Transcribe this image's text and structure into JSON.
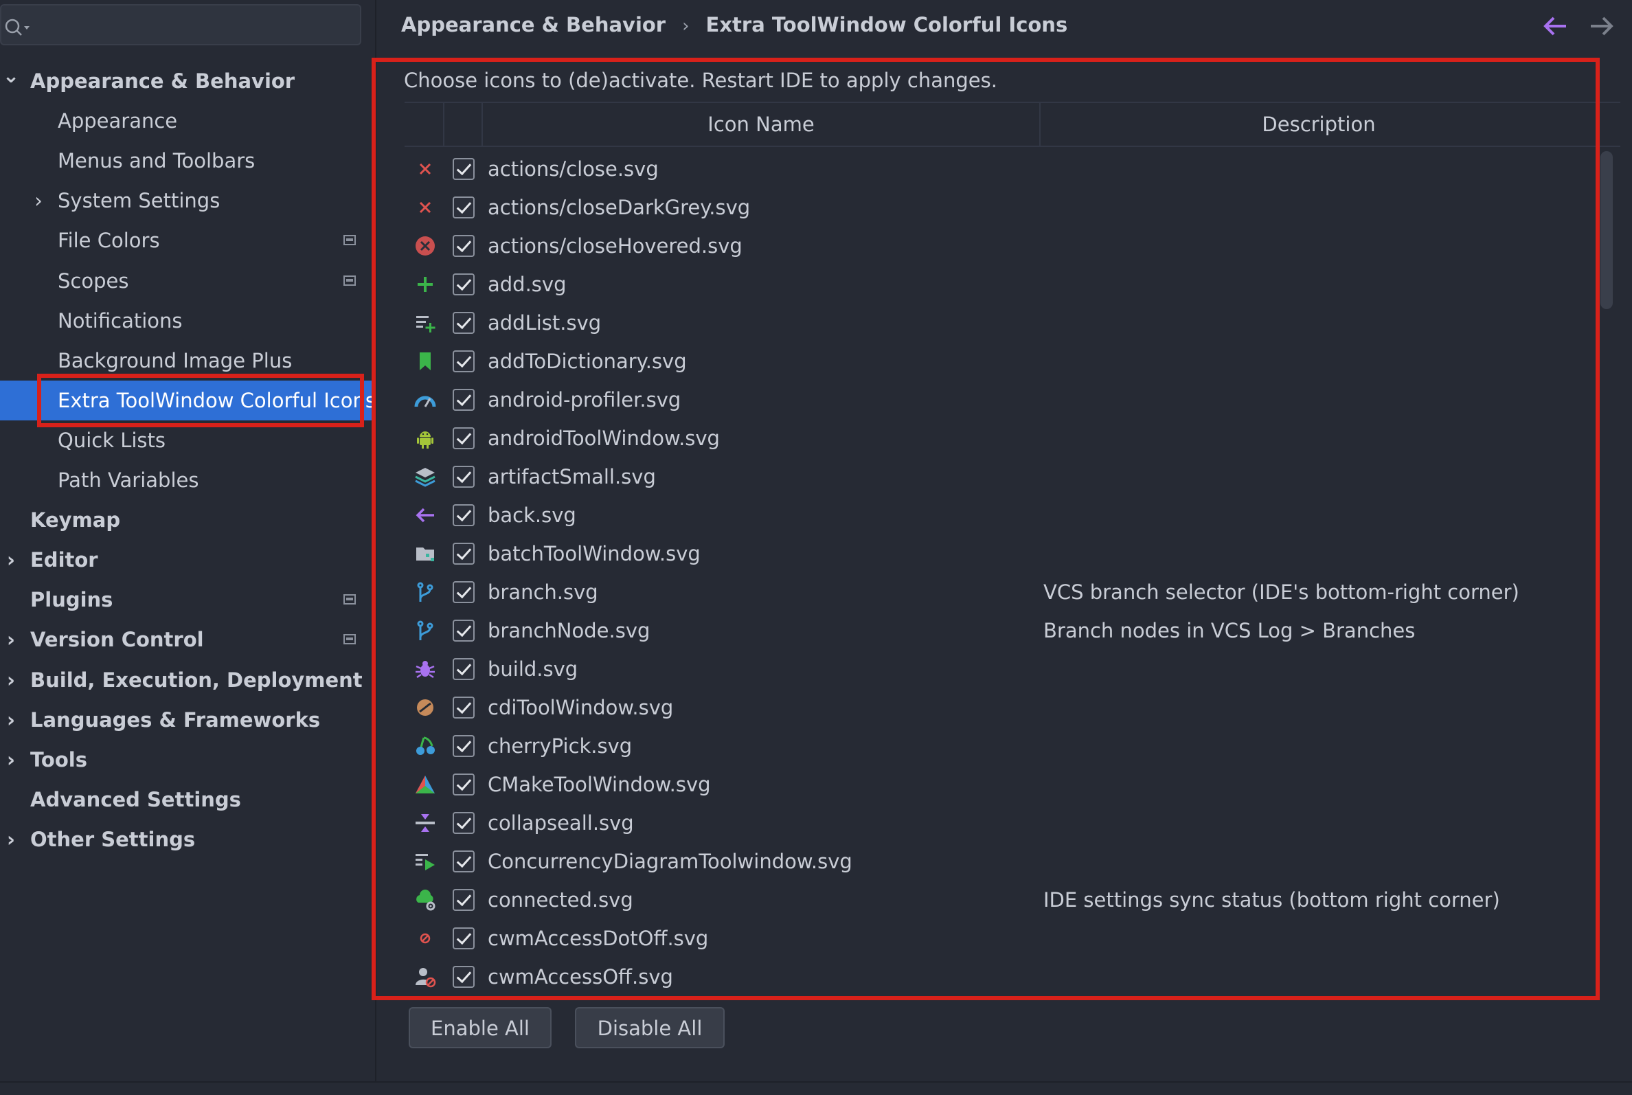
{
  "sidebar": {
    "search_placeholder": "",
    "items": [
      {
        "label": "Appearance & Behavior",
        "expander": "⌄",
        "bold": true,
        "level": 0
      },
      {
        "label": "Appearance",
        "expander": "",
        "bold": false,
        "level": 1
      },
      {
        "label": "Menus and Toolbars",
        "expander": "",
        "bold": false,
        "level": 1
      },
      {
        "label": "System Settings",
        "expander": "›",
        "bold": false,
        "level": 1
      },
      {
        "label": "File Colors",
        "expander": "",
        "bold": false,
        "level": 1,
        "project": true
      },
      {
        "label": "Scopes",
        "expander": "",
        "bold": false,
        "level": 1,
        "project": true
      },
      {
        "label": "Notifications",
        "expander": "",
        "bold": false,
        "level": 1
      },
      {
        "label": "Background Image Plus",
        "expander": "",
        "bold": false,
        "level": 1
      },
      {
        "label": "Extra ToolWindow Colorful Icons",
        "expander": "",
        "bold": false,
        "level": 1,
        "selected": true
      },
      {
        "label": "Quick Lists",
        "expander": "",
        "bold": false,
        "level": 1
      },
      {
        "label": "Path Variables",
        "expander": "",
        "bold": false,
        "level": 1
      },
      {
        "label": "Keymap",
        "expander": "",
        "bold": true,
        "level": 0
      },
      {
        "label": "Editor",
        "expander": "›",
        "bold": true,
        "level": 0
      },
      {
        "label": "Plugins",
        "expander": "",
        "bold": true,
        "level": 0,
        "project": true
      },
      {
        "label": "Version Control",
        "expander": "›",
        "bold": true,
        "level": 0,
        "project": true
      },
      {
        "label": "Build, Execution, Deployment",
        "expander": "›",
        "bold": true,
        "level": 0
      },
      {
        "label": "Languages & Frameworks",
        "expander": "›",
        "bold": true,
        "level": 0
      },
      {
        "label": "Tools",
        "expander": "›",
        "bold": true,
        "level": 0
      },
      {
        "label": "Advanced Settings",
        "expander": "",
        "bold": true,
        "level": 0
      },
      {
        "label": "Other Settings",
        "expander": "›",
        "bold": true,
        "level": 0
      }
    ]
  },
  "header": {
    "crumb_parent": "Appearance & Behavior",
    "crumb_sep": "›",
    "crumb_current": "Extra ToolWindow Colorful Icons",
    "back_icon": "arrow-left-icon",
    "forward_icon": "arrow-right-icon"
  },
  "main": {
    "instruction": "Choose icons to (de)activate. Restart IDE to apply changes.",
    "columns": {
      "icon": "",
      "enabled": "",
      "name": "Icon Name",
      "description": "Description"
    },
    "rows": [
      {
        "icon": "close",
        "name": "actions/close.svg",
        "description": "",
        "enabled": true
      },
      {
        "icon": "close",
        "name": "actions/closeDarkGrey.svg",
        "description": "",
        "enabled": true
      },
      {
        "icon": "close-hovered",
        "name": "actions/closeHovered.svg",
        "description": "",
        "enabled": true
      },
      {
        "icon": "add",
        "name": "add.svg",
        "description": "",
        "enabled": true
      },
      {
        "icon": "add-list",
        "name": "addList.svg",
        "description": "",
        "enabled": true
      },
      {
        "icon": "bookmark",
        "name": "addToDictionary.svg",
        "description": "",
        "enabled": true
      },
      {
        "icon": "gauge",
        "name": "android-profiler.svg",
        "description": "",
        "enabled": true
      },
      {
        "icon": "android",
        "name": "androidToolWindow.svg",
        "description": "",
        "enabled": true
      },
      {
        "icon": "layers",
        "name": "artifactSmall.svg",
        "description": "",
        "enabled": true
      },
      {
        "icon": "back",
        "name": "back.svg",
        "description": "",
        "enabled": true
      },
      {
        "icon": "folder-batch",
        "name": "batchToolWindow.svg",
        "description": "",
        "enabled": true
      },
      {
        "icon": "branch",
        "name": "branch.svg",
        "description": "VCS branch selector (IDE's bottom-right corner)",
        "enabled": true
      },
      {
        "icon": "branch",
        "name": "branchNode.svg",
        "description": "Branch nodes in VCS Log > Branches",
        "enabled": true
      },
      {
        "icon": "bug",
        "name": "build.svg",
        "description": "",
        "enabled": true
      },
      {
        "icon": "bean",
        "name": "cdiToolWindow.svg",
        "description": "",
        "enabled": true
      },
      {
        "icon": "cherry",
        "name": "cherryPick.svg",
        "description": "",
        "enabled": true
      },
      {
        "icon": "cmake",
        "name": "CMakeToolWindow.svg",
        "description": "",
        "enabled": true
      },
      {
        "icon": "collapse",
        "name": "collapseall.svg",
        "description": "",
        "enabled": true
      },
      {
        "icon": "concurrency",
        "name": "ConcurrencyDiagramToolwindow.svg",
        "description": "",
        "enabled": true
      },
      {
        "icon": "cloud-gear",
        "name": "connected.svg",
        "description": "IDE settings sync status (bottom right corner)",
        "enabled": true
      },
      {
        "icon": "dot-off",
        "name": "cwmAccessDotOff.svg",
        "description": "",
        "enabled": true
      },
      {
        "icon": "user-off",
        "name": "cwmAccessOff.svg",
        "description": "",
        "enabled": true
      }
    ]
  },
  "buttons": {
    "enable_all": "Enable All",
    "disable_all": "Disable All"
  },
  "colors": {
    "accent": "#2e6fd6",
    "highlight_outline": "#d8211a",
    "back_arrow": "#a872f0"
  }
}
